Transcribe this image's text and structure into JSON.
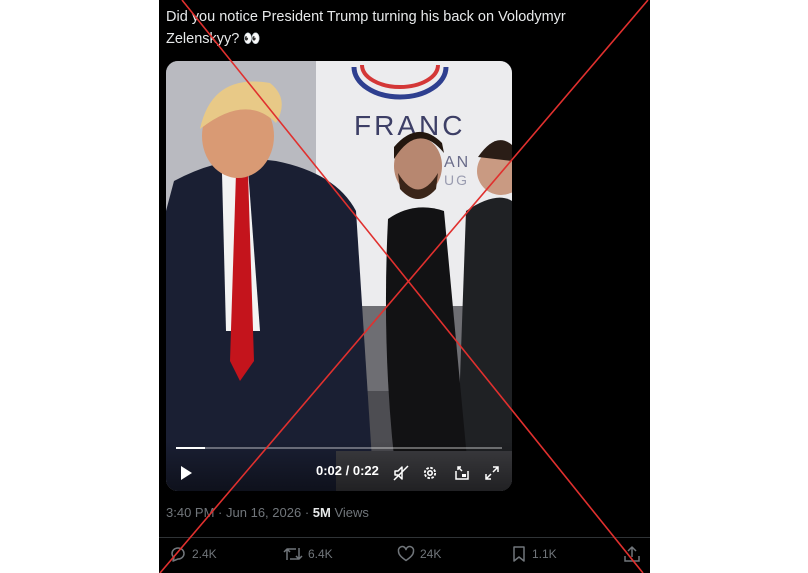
{
  "post": {
    "text": "Did you notice President Trump turning his back on Volodymyr Zelenskyy?",
    "emoji": "👀"
  },
  "video": {
    "backdrop_text_1": "FRANC",
    "backdrop_text_2": "AN",
    "backdrop_text_3": "UG",
    "time_display": "0:02 / 0:22",
    "progress_fraction": 0.09
  },
  "meta": {
    "time": "3:40 PM",
    "separator": "·",
    "date": "Jun 16, 2026",
    "views_count": "5M",
    "views_label": "Views"
  },
  "actions": {
    "replies": "2.4K",
    "reposts": "6.4K",
    "likes": "24K",
    "bookmarks": "1.1K"
  },
  "colors": {
    "background": "#000000",
    "text_primary": "#e7e9ea",
    "text_secondary": "#71767b",
    "cross": "#e0302e"
  }
}
